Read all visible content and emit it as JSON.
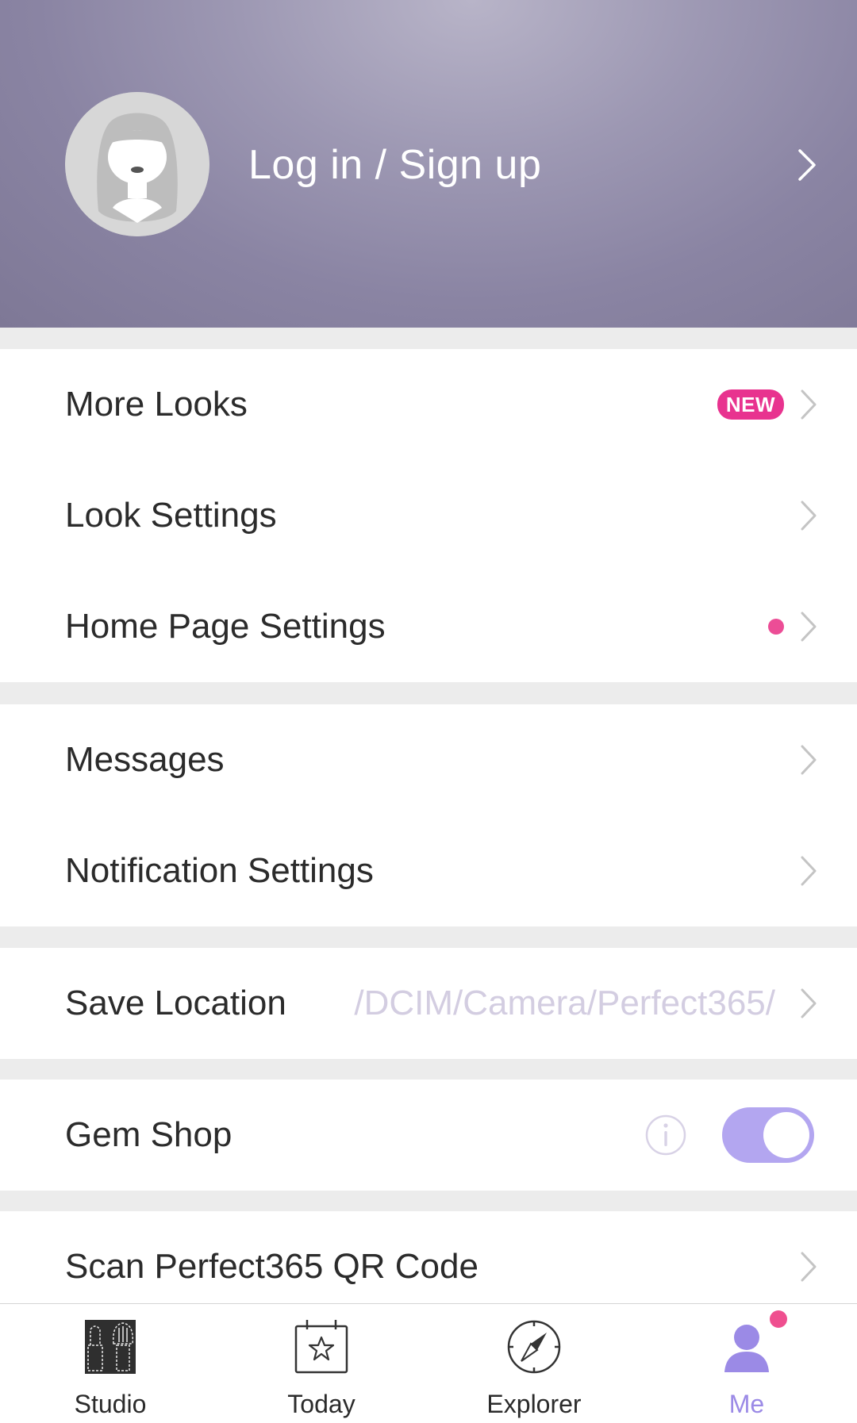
{
  "header": {
    "login_label": "Log in / Sign up"
  },
  "section1": {
    "items": [
      {
        "label": "More Looks",
        "badge": "NEW"
      },
      {
        "label": "Look Settings"
      },
      {
        "label": "Home Page Settings"
      }
    ]
  },
  "section2": {
    "items": [
      {
        "label": "Messages"
      },
      {
        "label": "Notification Settings"
      }
    ]
  },
  "section3": {
    "label": "Save Location",
    "path": "/DCIM/Camera/Perfect365/"
  },
  "section4": {
    "label": "Gem Shop",
    "toggle_on": true
  },
  "section5": {
    "label": "Scan Perfect365 QR Code"
  },
  "tabbar": {
    "tabs": [
      {
        "label": "Studio",
        "icon": "makeup-brush-icon"
      },
      {
        "label": "Today",
        "icon": "calendar-star-icon"
      },
      {
        "label": "Explorer",
        "icon": "compass-icon"
      },
      {
        "label": "Me",
        "icon": "person-icon",
        "active": true
      }
    ]
  },
  "colors": {
    "accent": "#9b8ae6",
    "toggle": "#b3a6f0",
    "badge": "#e8338f",
    "dot": "#ec4d96",
    "header_top": "#b8b4c8",
    "header_bottom": "#7e7896"
  }
}
